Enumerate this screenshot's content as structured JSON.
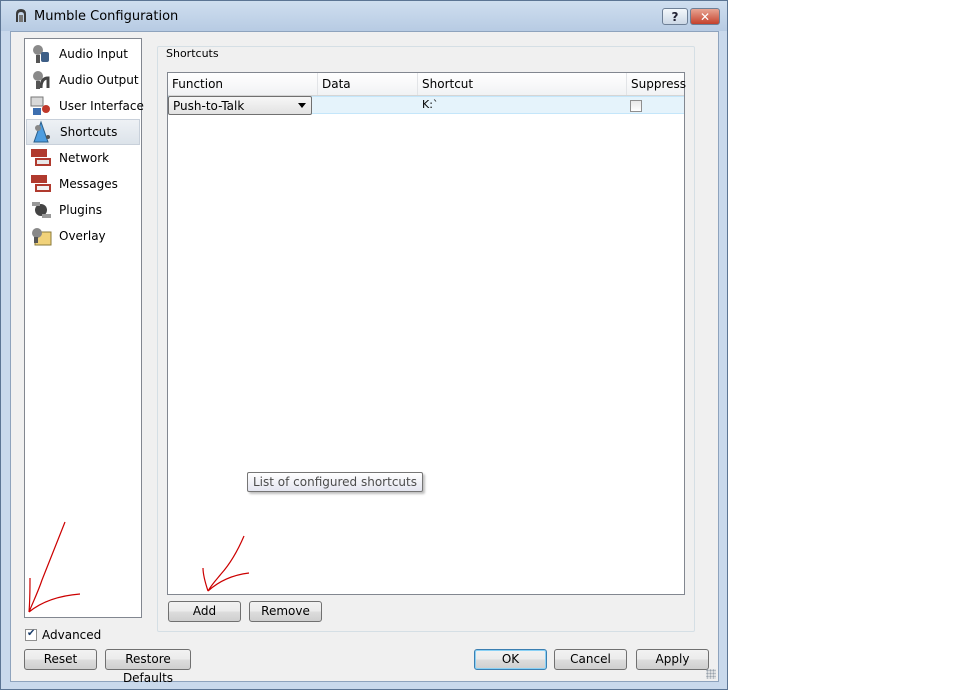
{
  "window": {
    "title": "Mumble Configuration",
    "help_label": "?",
    "close_label": "✕"
  },
  "sidebar": {
    "items": [
      {
        "label": "Audio Input",
        "icon": "microphone-icon"
      },
      {
        "label": "Audio Output",
        "icon": "headphones-icon"
      },
      {
        "label": "User Interface",
        "icon": "user-interface-icon"
      },
      {
        "label": "Shortcuts",
        "icon": "shortcuts-icon"
      },
      {
        "label": "Network",
        "icon": "network-icon"
      },
      {
        "label": "Messages",
        "icon": "messages-icon"
      },
      {
        "label": "Plugins",
        "icon": "plugins-icon"
      },
      {
        "label": "Overlay",
        "icon": "overlay-icon"
      }
    ],
    "selected": "Shortcuts"
  },
  "shortcuts": {
    "group_title": "Shortcuts",
    "columns": [
      "Function",
      "Data",
      "Shortcut",
      "Suppress"
    ],
    "rows": [
      {
        "function": "Push-to-Talk",
        "data": "",
        "shortcut": "K:`",
        "suppress": false
      }
    ],
    "tooltip": "List of configured shortcuts",
    "add_label": "Add",
    "remove_label": "Remove"
  },
  "advanced": {
    "label": "Advanced",
    "checked": true
  },
  "footer": {
    "reset_label": "Reset",
    "restore_label": "Restore Defaults",
    "ok_label": "OK",
    "cancel_label": "Cancel",
    "apply_label": "Apply"
  },
  "colors": {
    "selection_row": "#e5f3fb",
    "titlebar": "#c9d9ec",
    "annotation": "#cc0000"
  }
}
